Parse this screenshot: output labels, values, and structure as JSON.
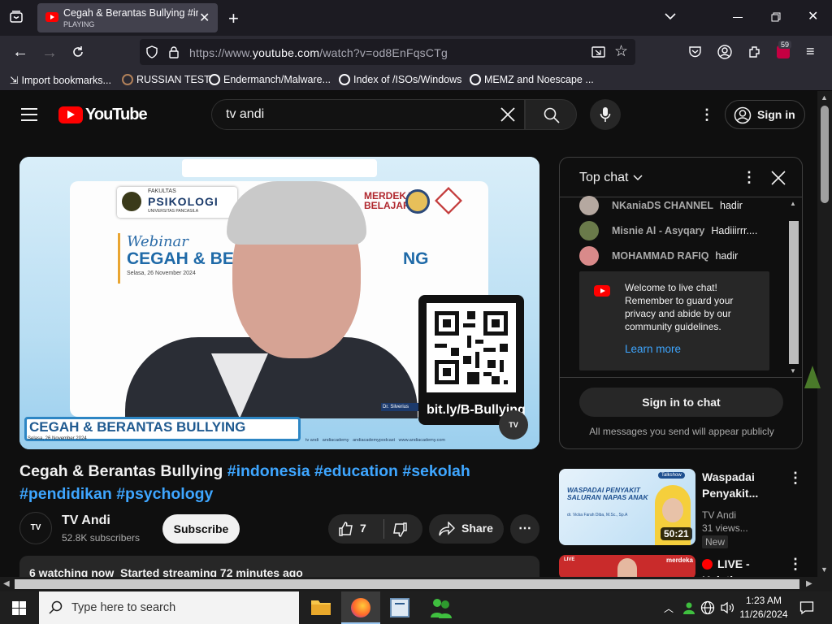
{
  "browser": {
    "tab": {
      "title": "Cegah & Berantas Bullying #indonesia",
      "status": "PLAYING"
    },
    "url_prefix": "https://www.",
    "url_main": "youtube.com",
    "url_suffix": "/watch?v=od8EnFqsCTg",
    "bookmarks": [
      {
        "label": "Import bookmarks...",
        "icon": "import-icon"
      },
      {
        "label": "RUSSIAN TEST",
        "icon": "bookmark-favicon"
      },
      {
        "label": "Endermanch/Malware...",
        "icon": "globe-icon"
      },
      {
        "label": "Index of /ISOs/Windows",
        "icon": "globe-icon"
      },
      {
        "label": "MEMZ and Noescape ...",
        "icon": "globe-icon"
      }
    ],
    "extension_badge": "59"
  },
  "youtube": {
    "logo": "YouTube",
    "search_value": "tv andi",
    "sign_in": "Sign in"
  },
  "video": {
    "title_plain": "Cegah & Berantas Bullying ",
    "title_tags_line1": "#indonesia #education #sekolah",
    "title_tags_line2": "#pendidikan #psychology",
    "overlay": {
      "faculty_line1": "FAKULTAS",
      "faculty_line2": "PSIKOLOGI",
      "faculty_line3": "UNIVERSITAS PANCASILA",
      "merdeka1": "MERDEKA",
      "merdeka2": "BELAJAR",
      "webinar": "Webinar",
      "big_title": "CEGAH & BE",
      "big_title_end": "NG",
      "date": "Selasa, 26 November 2024",
      "bottom_title": "CEGAH & BERANTAS BULLYING",
      "bottom_date": "Selasa, 26 November 2024",
      "qr_link": "bit.ly/B-Bullying",
      "speaker": "Dr. Silverius",
      "socials": "tv andi   andiacademy   andiacademypodcast   www.andiacademy.com"
    },
    "channel": "TV Andi",
    "subscribers": "52.8K subscribers",
    "subscribe": "Subscribe",
    "likes": "7",
    "share": "Share",
    "description_line": "6 watching now  Started streaming 72 minutes ago"
  },
  "chat": {
    "header": "Top chat",
    "messages": [
      {
        "author": "NKaniaDS CHANNEL",
        "text": "hadir",
        "color": "#b5a8a0"
      },
      {
        "author": "Misnie Al - Asyqary",
        "text": "Hadiiirrr....",
        "color": "#6a7a4a"
      },
      {
        "author": "MOHAMMAD RAFIQ",
        "text": "hadir",
        "color": "#d98a8a"
      }
    ],
    "welcome": "Welcome to live chat! Remember to guard your privacy and abide by our community guidelines.",
    "learn_more": "Learn more",
    "sign_in_chat": "Sign in to chat",
    "footer": "All messages you send will appear publicly"
  },
  "recommendations": [
    {
      "title": "Waspadai Penyakit...",
      "channel": "TV Andi",
      "meta": "31 views...",
      "badge": "New",
      "duration": "50:21",
      "thumb_title": "WASPADAI PENYAKIT SALURAN NAPAS ANAK",
      "thumb_speaker": "dr. Vicka Farah Diba, M.Sc., Sp.A",
      "thumb_tag": "Talkshow"
    },
    {
      "title": "LIVE - Keistimewaan...",
      "live_label": "LIVE -",
      "live_line2": "Keistimewaan...",
      "thumb_brand": "merdeka",
      "thumb_live": "LIVE"
    }
  ],
  "taskbar": {
    "search_placeholder": "Type here to search",
    "time": "1:23 AM",
    "date": "11/26/2024"
  },
  "colors": {
    "accent": "#3ea6ff",
    "youtube_red": "#ff0000",
    "chat_link": "#3ea6ff"
  }
}
